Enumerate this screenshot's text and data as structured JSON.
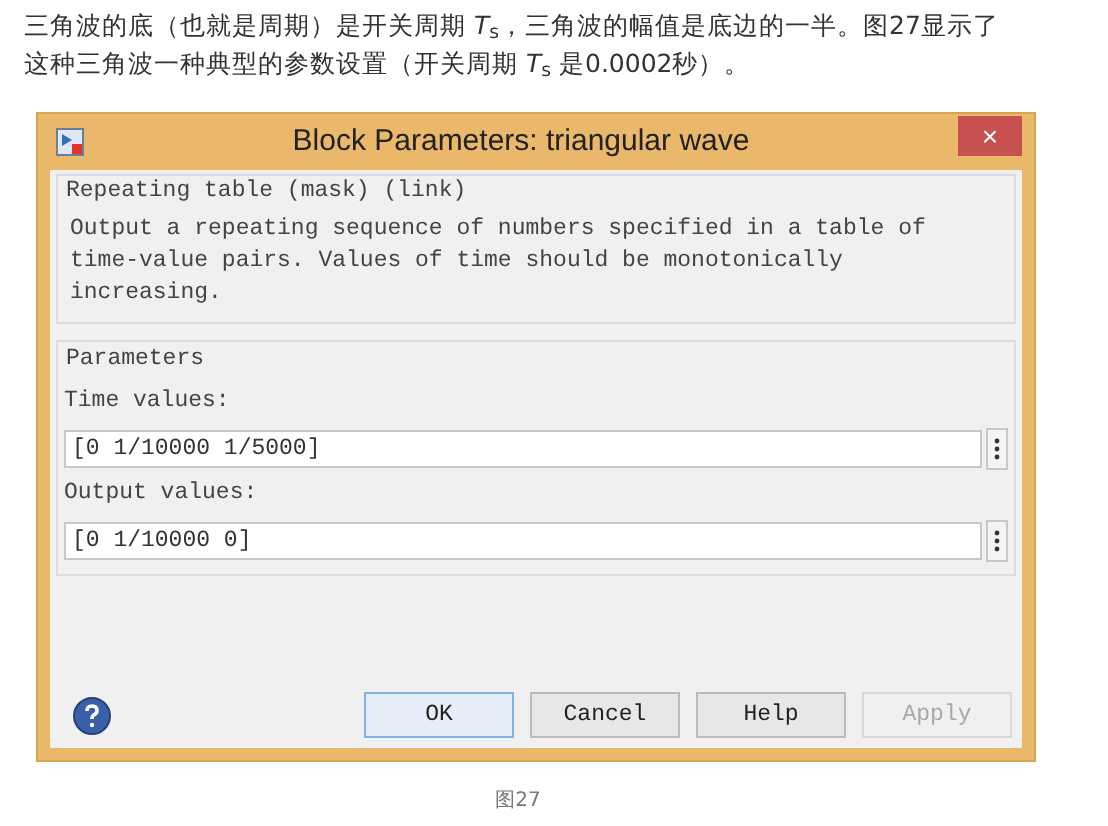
{
  "article": {
    "paragraph": "三角波的底（也就是周期）是开关周期 *T*$_{s}$，三角波的幅值是底边的一半。图27显示了这种三角波一种典型的参数设置（开关周期 *T*$_{s}$ 是0.0002秒）。",
    "caption": "图27"
  },
  "dialog": {
    "title": "Block Parameters: triangular wave",
    "close": "×",
    "description_group": {
      "legend": "Repeating table (mask) (link)",
      "text": "Output a repeating sequence of numbers specified in a table of time-value pairs. Values of time should be monotonically increasing."
    },
    "parameters_group": {
      "legend": "Parameters",
      "fields": [
        {
          "label": "Time values:",
          "value": "[0 1/10000 1/5000]"
        },
        {
          "label": "Output values:",
          "value": "[0 1/10000 0]"
        }
      ]
    },
    "buttons": [
      {
        "label": "OK",
        "default": true,
        "disabled": false
      },
      {
        "label": "Cancel",
        "default": false,
        "disabled": false
      },
      {
        "label": "Help",
        "default": false,
        "disabled": false
      },
      {
        "label": "Apply",
        "default": false,
        "disabled": true
      }
    ]
  }
}
